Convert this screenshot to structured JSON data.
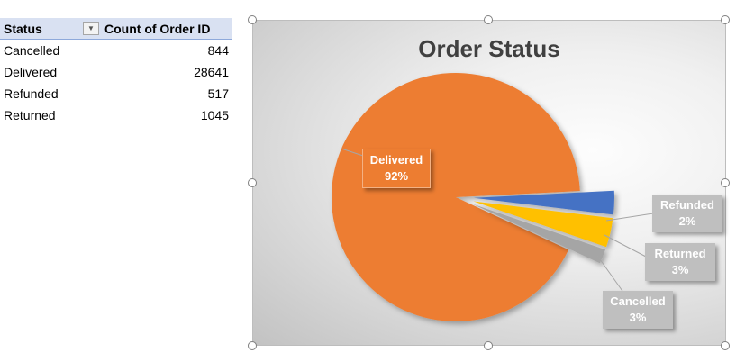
{
  "pivot": {
    "headers": [
      "Status",
      "Count of Order ID"
    ],
    "filter_icon": "dropdown-arrow-icon",
    "rows": [
      {
        "status": "Cancelled",
        "count": "844"
      },
      {
        "status": "Delivered",
        "count": "28641"
      },
      {
        "status": "Refunded",
        "count": "517"
      },
      {
        "status": "Returned",
        "count": "1045"
      }
    ]
  },
  "chart_data": {
    "type": "pie",
    "title": "Order Status",
    "slices": [
      {
        "name": "Delivered",
        "value": 28641,
        "label": "92%",
        "color": "#ed7d31"
      },
      {
        "name": "Refunded",
        "value": 517,
        "label": "2%",
        "color": "#a5a5a5"
      },
      {
        "name": "Returned",
        "value": 1045,
        "label": "3%",
        "color": "#ffc000"
      },
      {
        "name": "Cancelled",
        "value": 844,
        "label": "3%",
        "color": "#4472c4"
      }
    ],
    "legend": "none"
  }
}
